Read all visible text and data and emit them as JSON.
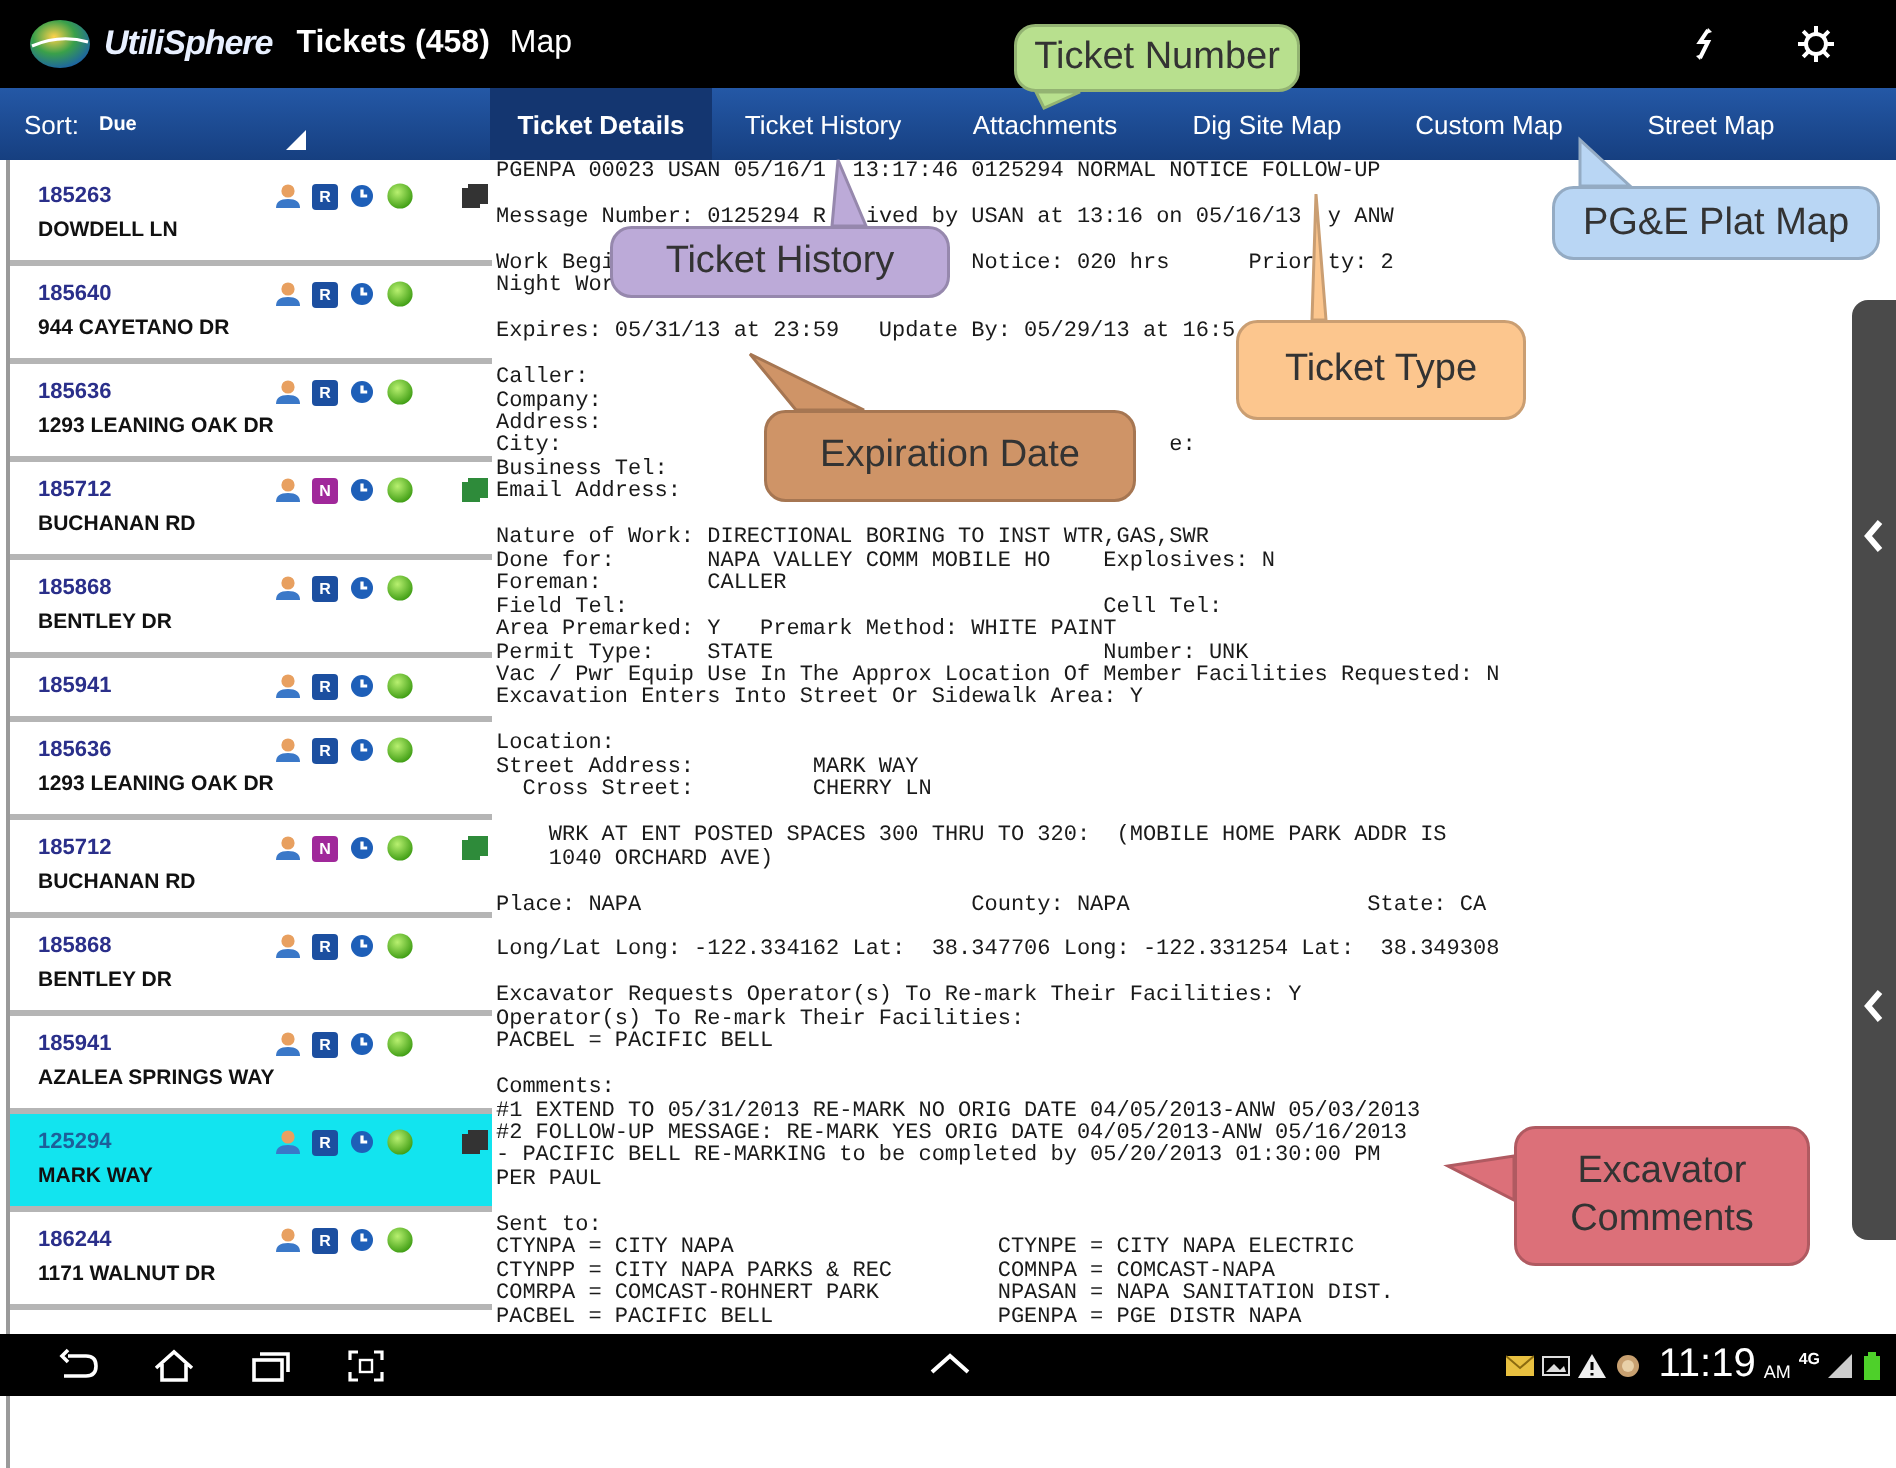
{
  "app": {
    "logo": "UtiliSphere",
    "title": "Tickets (458)",
    "map_button": "Map"
  },
  "sort": {
    "label": "Sort:",
    "value": "Due"
  },
  "tabs": [
    {
      "label": "Ticket Details",
      "selected": true
    },
    {
      "label": "Ticket History",
      "selected": false
    },
    {
      "label": "Attachments",
      "selected": false
    },
    {
      "label": "Dig Site Map",
      "selected": false
    },
    {
      "label": "Custom Map",
      "selected": false
    },
    {
      "label": "Street Map",
      "selected": false
    }
  ],
  "tickets": [
    {
      "id": "185263",
      "address": "DOWDELL LN",
      "badge": {
        "letter": "R",
        "color": "#1c4fa0"
      },
      "attachment": {
        "color": "#333333"
      },
      "selected": false
    },
    {
      "id": "185640",
      "address": "944 CAYETANO DR",
      "badge": {
        "letter": "R",
        "color": "#1c4fa0"
      },
      "selected": false
    },
    {
      "id": "185636",
      "address": "1293 LEANING OAK DR",
      "badge": {
        "letter": "R",
        "color": "#1c4fa0"
      },
      "selected": false
    },
    {
      "id": "185712",
      "address": "BUCHANAN RD",
      "badge": {
        "letter": "N",
        "color": "#a0289a"
      },
      "attachment": {
        "color": "#2e8b3a"
      },
      "selected": false
    },
    {
      "id": "185868",
      "address": "BENTLEY DR",
      "badge": {
        "letter": "R",
        "color": "#1c4fa0"
      },
      "selected": false
    },
    {
      "id": "185941",
      "badge": {
        "letter": "R",
        "color": "#1c4fa0"
      },
      "selected": false
    },
    {
      "id": "185636",
      "address": "1293 LEANING OAK DR",
      "badge": {
        "letter": "R",
        "color": "#1c4fa0"
      },
      "selected": false
    },
    {
      "id": "185712",
      "address": "BUCHANAN RD",
      "badge": {
        "letter": "N",
        "color": "#a0289a"
      },
      "attachment": {
        "color": "#2e8b3a"
      },
      "selected": false
    },
    {
      "id": "185868",
      "address": "BENTLEY DR",
      "badge": {
        "letter": "R",
        "color": "#1c4fa0"
      },
      "selected": false
    },
    {
      "id": "185941",
      "address": "AZALEA SPRINGS WAY",
      "badge": {
        "letter": "R",
        "color": "#1c4fa0"
      },
      "selected": false
    },
    {
      "id": "125294",
      "address": "MARK WAY",
      "badge": {
        "letter": "R",
        "color": "#1c4fa0"
      },
      "attachment": {
        "color": "#333333"
      },
      "selected": true
    },
    {
      "id": "186244",
      "address": "1171 WALNUT DR",
      "badge": {
        "letter": "R",
        "color": "#1c4fa0"
      },
      "selected": false
    }
  ],
  "ticket_text": [
    [
      [
        "PGENPA 00023 USAN 05/16/1",
        "  13:17:46 0125294 NORMAL NOTICE FOLLOW-UP"
      ]
    ],
    [
      [
        "Message Number: 0125294 R",
        "   ived by USAN at 13:16 on 05/16/13",
        "  y ANW"
      ]
    ],
    [
      [
        "Work Begi",
        "                           Notice: 020 hrs      Prior",
        " ty: 2"
      ],
      "Night Wor"
    ],
    [
      "Expires: 05/31/13 at 23:59   Update By: 05/29/13 at 16:5"
    ],
    [
      "Caller:",
      "Company:",
      "Address:",
      [
        "City:",
        "                                              e:"
      ],
      "Business Tel:",
      "Email Address:"
    ],
    [
      "Nature of Work: DIRECTIONAL BORING TO INST WTR,GAS,SWR",
      "Done for:       NAPA VALLEY COMM MOBILE HO    Explosives: N",
      "Foreman:        CALLER",
      "Field Tel:                                    Cell Tel:",
      "Area Premarked: Y   Premark Method: WHITE PAINT",
      "Permit Type:    STATE                         Number: UNK",
      "Vac / Pwr Equip Use In The Approx Location Of Member Facilities Requested: N",
      "Excavation Enters Into Street Or Sidewalk Area: Y"
    ],
    [
      "Location:",
      "Street Address:         MARK WAY",
      "  Cross Street:         CHERRY LN"
    ],
    [
      "    WRK AT ENT POSTED SPACES 300 THRU TO 320:  (MOBILE HOME PARK ADDR IS",
      "    1040 ORCHARD AVE)"
    ],
    [
      "Place: NAPA                         County: NAPA                  State: CA"
    ],
    [
      "Long/Lat Long: -122.334162 Lat:  38.347706 Long: -122.331254 Lat:  38.349308"
    ],
    [
      "Excavator Requests Operator(s) To Re-mark Their Facilities: Y",
      "Operator(s) To Re-mark Their Facilities:",
      "PACBEL = PACIFIC BELL"
    ],
    [
      "Comments:",
      "#1 EXTEND TO 05/31/2013 RE-MARK NO ORIG DATE 04/05/2013-ANW 05/03/2013",
      "#2 FOLLOW-UP MESSAGE: RE-MARK YES ORIG DATE 04/05/2013-ANW 05/16/2013",
      "- PACIFIC BELL RE-MARKING to be completed by 05/20/2013 01:30:00 PM",
      "PER PAUL"
    ],
    [
      "Sent to:",
      "CTYNPA = CITY NAPA                    CTYNPE = CITY NAPA ELECTRIC",
      "CTYNPP = CITY NAPA PARKS & REC        COMNPA = COMCAST-NAPA",
      "COMRPA = COMCAST-ROHNERT PARK         NPASAN = NAPA SANITATION DIST.",
      "PACBEL = PACIFIC BELL                 PGENPA = PGE DISTR NAPA"
    ]
  ],
  "callouts": [
    {
      "text": "Ticket Number",
      "color": "#b8e08e"
    },
    {
      "text": "Ticket History",
      "color": "#bcaad8"
    },
    {
      "text": "PG&E Plat Map",
      "color": "#b9d6f4"
    },
    {
      "text": "Ticket Type",
      "color": "#fcc68e"
    },
    {
      "text": "Expiration Date",
      "color": "#cf9467"
    },
    {
      "text": "Excavator Comments",
      "color": "#dc7079"
    }
  ],
  "status_bar": {
    "time": "11:19",
    "ampm": "AM",
    "network": "4G"
  }
}
